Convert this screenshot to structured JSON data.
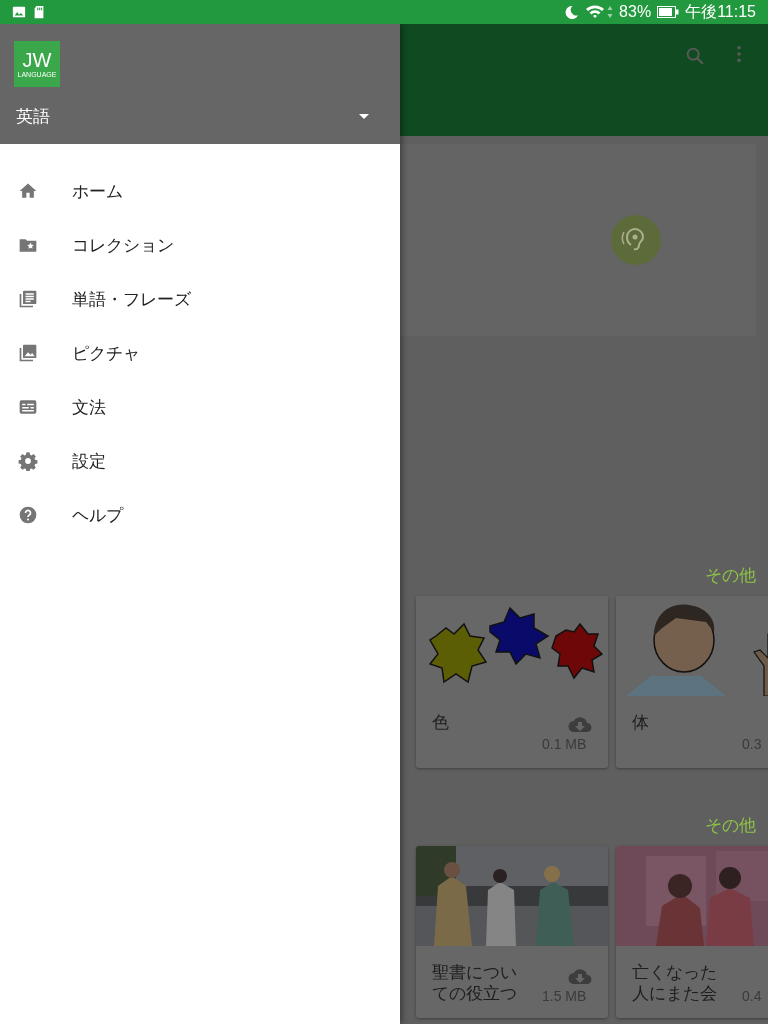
{
  "status_bar": {
    "battery": "83%",
    "time": "午後11:15"
  },
  "drawer": {
    "logo": {
      "title": "JW",
      "subtitle": "LANGUAGE"
    },
    "language": "英語",
    "items": [
      {
        "kind": "home",
        "label": "ホーム"
      },
      {
        "kind": "collection",
        "label": "コレクション"
      },
      {
        "kind": "words",
        "label": "単語・フレーズ"
      },
      {
        "kind": "pictures",
        "label": "ピクチャ"
      },
      {
        "kind": "grammar",
        "label": "文法"
      },
      {
        "kind": "settings",
        "label": "設定"
      },
      {
        "kind": "help",
        "label": "ヘルプ"
      }
    ]
  },
  "content": {
    "sections": [
      {
        "more": "その他",
        "cards": [
          {
            "kind": "picture",
            "title": "色",
            "size": "0.1 MB",
            "download": true
          },
          {
            "kind": "picture",
            "title": "体",
            "size": "0.3"
          }
        ]
      },
      {
        "more": "その他",
        "cards": [
          {
            "kind": "picture",
            "title": "聖書についての役立つ",
            "size": "1.5 MB",
            "download": true
          },
          {
            "kind": "picture",
            "title": "亡くなった人にまた会",
            "size": "0.4"
          }
        ]
      }
    ]
  }
}
